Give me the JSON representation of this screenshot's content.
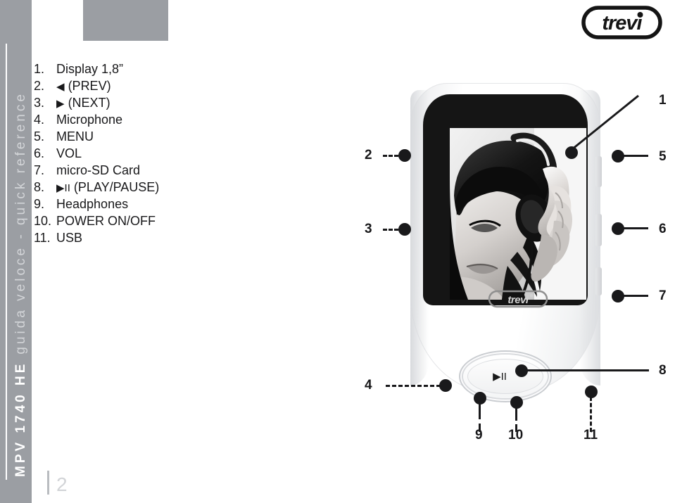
{
  "document": {
    "page_number": "2",
    "spine_label_bold": "MPV 1740 HE",
    "spine_label_light": "guida veloce - quick reference",
    "spine_label_full": "MPV 1740 HE guida veloce - quick reference"
  },
  "brand": {
    "logo_text": "trevi",
    "logo_icon": "trevi-pill-logo-icon",
    "device_logo_text": "trevi"
  },
  "legend": {
    "items": [
      {
        "num": "1.",
        "label": "Display 1,8”",
        "glyph": ""
      },
      {
        "num": "2.",
        "label": "(PREV)",
        "glyph": "◀"
      },
      {
        "num": "3.",
        "label": "(NEXT)",
        "glyph": "▶"
      },
      {
        "num": "4.",
        "label": "Microphone",
        "glyph": ""
      },
      {
        "num": "5.",
        "label": "MENU",
        "glyph": ""
      },
      {
        "num": "6.",
        "label": "VOL",
        "glyph": ""
      },
      {
        "num": "7.",
        "label": "micro-SD Card",
        "glyph": ""
      },
      {
        "num": "8.",
        "label": "(PLAY/PAUSE)",
        "glyph": "▶II"
      },
      {
        "num": "9.",
        "label": "Headphones",
        "glyph": ""
      },
      {
        "num": "10.",
        "label": "POWER ON/OFF",
        "glyph": ""
      },
      {
        "num": "11.",
        "label": "USB",
        "glyph": ""
      }
    ]
  },
  "device": {
    "name": "MPV 1740 HE portable media player",
    "screen_image_description": "black and white photo of a woman wearing headphones",
    "play_pause_glyph": "▶II",
    "callouts": [
      {
        "id": "1",
        "side": "right",
        "target": "display"
      },
      {
        "id": "2",
        "side": "left",
        "target": "prev-button"
      },
      {
        "id": "3",
        "side": "left",
        "target": "next-button"
      },
      {
        "id": "4",
        "side": "left",
        "target": "microphone"
      },
      {
        "id": "5",
        "side": "right",
        "target": "menu-button"
      },
      {
        "id": "6",
        "side": "right",
        "target": "vol-button"
      },
      {
        "id": "7",
        "side": "right",
        "target": "micro-sd-card"
      },
      {
        "id": "8",
        "side": "right",
        "target": "play-pause-button"
      },
      {
        "id": "9",
        "side": "bottom",
        "target": "headphones-jack"
      },
      {
        "id": "10",
        "side": "bottom",
        "target": "power-on-off"
      },
      {
        "id": "11",
        "side": "bottom",
        "target": "usb-port"
      }
    ]
  },
  "colors": {
    "sidebar_gray": "#9b9ea3",
    "ink": "#18181a",
    "page_number_gray": "#d2d4d7",
    "device_white": "#ffffff",
    "bezel_black": "#151515"
  }
}
